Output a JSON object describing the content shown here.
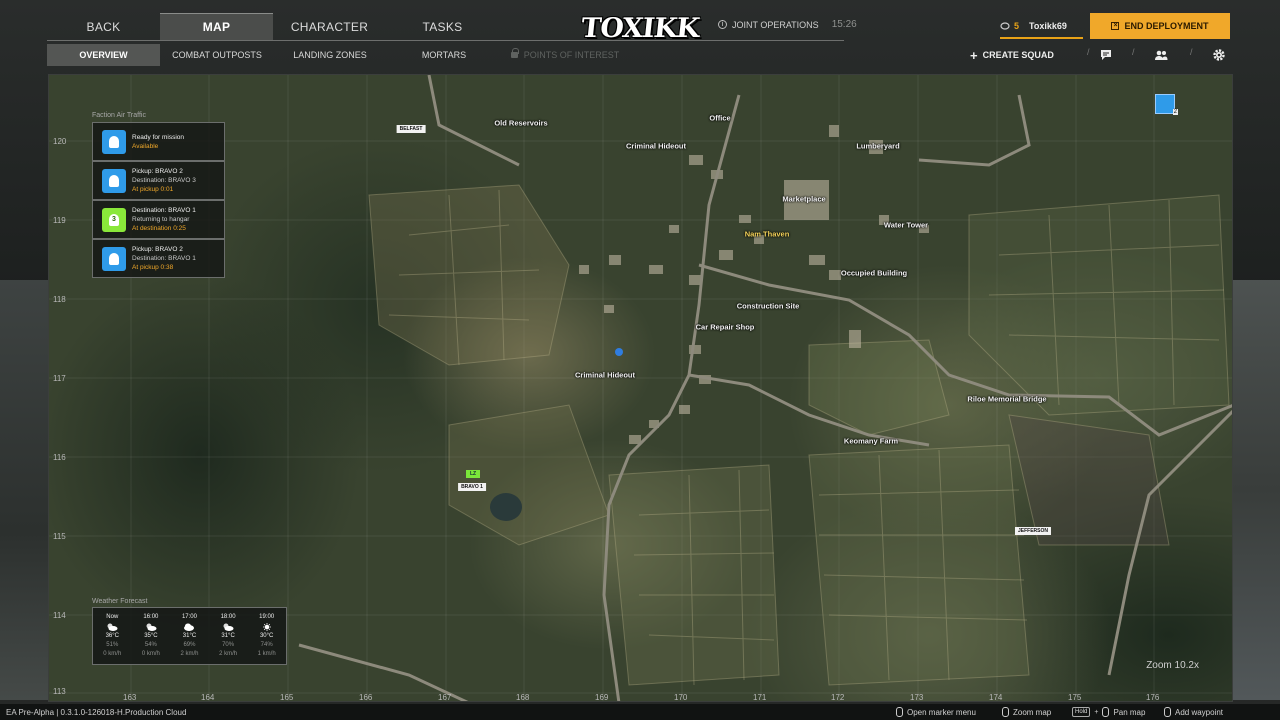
{
  "nav": {
    "tabs": [
      {
        "label": "BACK"
      },
      {
        "label": "MAP"
      },
      {
        "label": "CHARACTER"
      },
      {
        "label": "TASKS"
      }
    ]
  },
  "logo": "TOXIKK",
  "status": {
    "mode": "JOINT OPERATIONS",
    "time": "15:26"
  },
  "player": {
    "rank": "5",
    "name": "Toxikk69"
  },
  "end_button": "END DEPLOYMENT",
  "subnav": {
    "tabs": [
      {
        "label": "OVERVIEW"
      },
      {
        "label": "COMBAT OUTPOSTS"
      },
      {
        "label": "LANDING ZONES"
      },
      {
        "label": "MORTARS"
      },
      {
        "label": "POINTS OF INTEREST"
      }
    ]
  },
  "tools": {
    "create_squad": "CREATE SQUAD"
  },
  "grid": {
    "y_labels": [
      "120",
      "119",
      "118",
      "117",
      "116",
      "115",
      "114",
      "113"
    ],
    "x_labels": [
      "163",
      "164",
      "165",
      "166",
      "167",
      "168",
      "169",
      "170",
      "171",
      "172",
      "173",
      "174",
      "175",
      "176"
    ]
  },
  "places": [
    {
      "label": "Old Reservoirs",
      "highlight": false
    },
    {
      "label": "Office",
      "highlight": false
    },
    {
      "label": "Criminal Hideout",
      "highlight": false
    },
    {
      "label": "Lumberyard",
      "highlight": false
    },
    {
      "label": "Marketplace",
      "highlight": false
    },
    {
      "label": "Nam Thaven",
      "highlight": true
    },
    {
      "label": "Water Tower",
      "highlight": false
    },
    {
      "label": "Occupied Building",
      "highlight": false
    },
    {
      "label": "Construction Site",
      "highlight": false
    },
    {
      "label": "Car Repair Shop",
      "highlight": false
    },
    {
      "label": "Criminal Hideout",
      "highlight": false
    },
    {
      "label": "Riloe Memorial Bridge",
      "highlight": false
    },
    {
      "label": "Keomany Farm",
      "highlight": false
    }
  ],
  "zones": {
    "belfast": "BELFAST",
    "bravo1": "BRAVO 1",
    "jefferson": "JEFFERSON",
    "lz": "LZ",
    "squad_num": "2"
  },
  "air_traffic": {
    "title": "Faction Air Traffic",
    "items": [
      {
        "line1": "Ready for mission",
        "line2": "",
        "line3": "Available",
        "status": "available",
        "badge": ""
      },
      {
        "line1": "Pickup: BRAVO 2",
        "line2": "Destination: BRAVO 3",
        "line3": "At pickup 0:01",
        "status": "blue",
        "badge": ""
      },
      {
        "line1": "Destination: BRAVO 1",
        "line2": "Returning to hangar",
        "line3": "At destination 0:25",
        "status": "green",
        "badge": "3"
      },
      {
        "line1": "Pickup: BRAVO 2",
        "line2": "Destination: BRAVO 1",
        "line3": "At pickup 0:38",
        "status": "blue",
        "badge": ""
      }
    ]
  },
  "weather": {
    "title": "Weather Forecast",
    "cols": [
      {
        "time": "Now",
        "icon": "partly-cloudy-icon",
        "temp": "36°C",
        "humidity": "51%",
        "wind": "0 km/h"
      },
      {
        "time": "16:00",
        "icon": "partly-cloudy-icon",
        "temp": "35°C",
        "humidity": "54%",
        "wind": "0 km/h"
      },
      {
        "time": "17:00",
        "icon": "cloudy-icon",
        "temp": "31°C",
        "humidity": "69%",
        "wind": "2 km/h"
      },
      {
        "time": "18:00",
        "icon": "partly-cloudy-icon",
        "temp": "31°C",
        "humidity": "70%",
        "wind": "2 km/h"
      },
      {
        "time": "19:00",
        "icon": "sunny-icon",
        "temp": "30°C",
        "humidity": "74%",
        "wind": "1 km/h"
      }
    ]
  },
  "zoom": "Zoom 10.2x",
  "footer": {
    "version": "EA Pre-Alpha | 0.3.1.0-126018-H.Production Cloud",
    "hints": [
      {
        "label": "Open marker menu"
      },
      {
        "label": "Zoom map"
      },
      {
        "key": "Hold",
        "label": "Pan map"
      },
      {
        "label": "Add waypoint"
      }
    ]
  },
  "colors": {
    "accent": "#f0a82a",
    "friendly": "#2f9be9",
    "lz": "#7be63a"
  }
}
